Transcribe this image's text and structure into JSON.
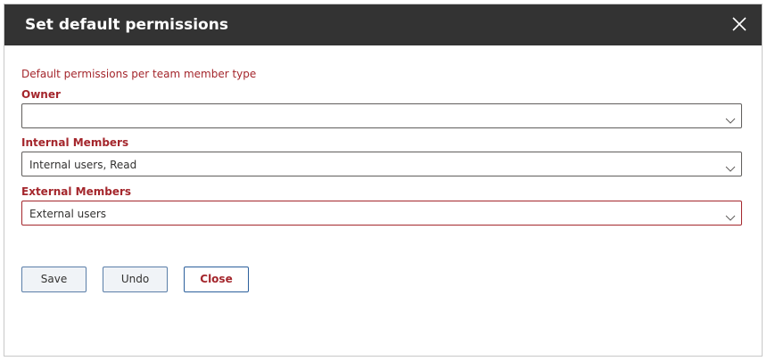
{
  "dialog": {
    "title": "Set default permissions"
  },
  "form": {
    "section_label": "Default permissions per team member type",
    "fields": [
      {
        "label": "Owner",
        "value": ""
      },
      {
        "label": "Internal Members",
        "value": "Internal users, Read"
      },
      {
        "label": "External Members",
        "value": "External users"
      }
    ]
  },
  "buttons": {
    "save": "Save",
    "undo": "Undo",
    "close": "Close"
  },
  "icons": {
    "close": "close-icon",
    "dropdown": "chevron-down-icon"
  },
  "colors": {
    "titlebar": "#333333",
    "label_red": "#a4262c",
    "button_border": "#2b5f9c"
  }
}
